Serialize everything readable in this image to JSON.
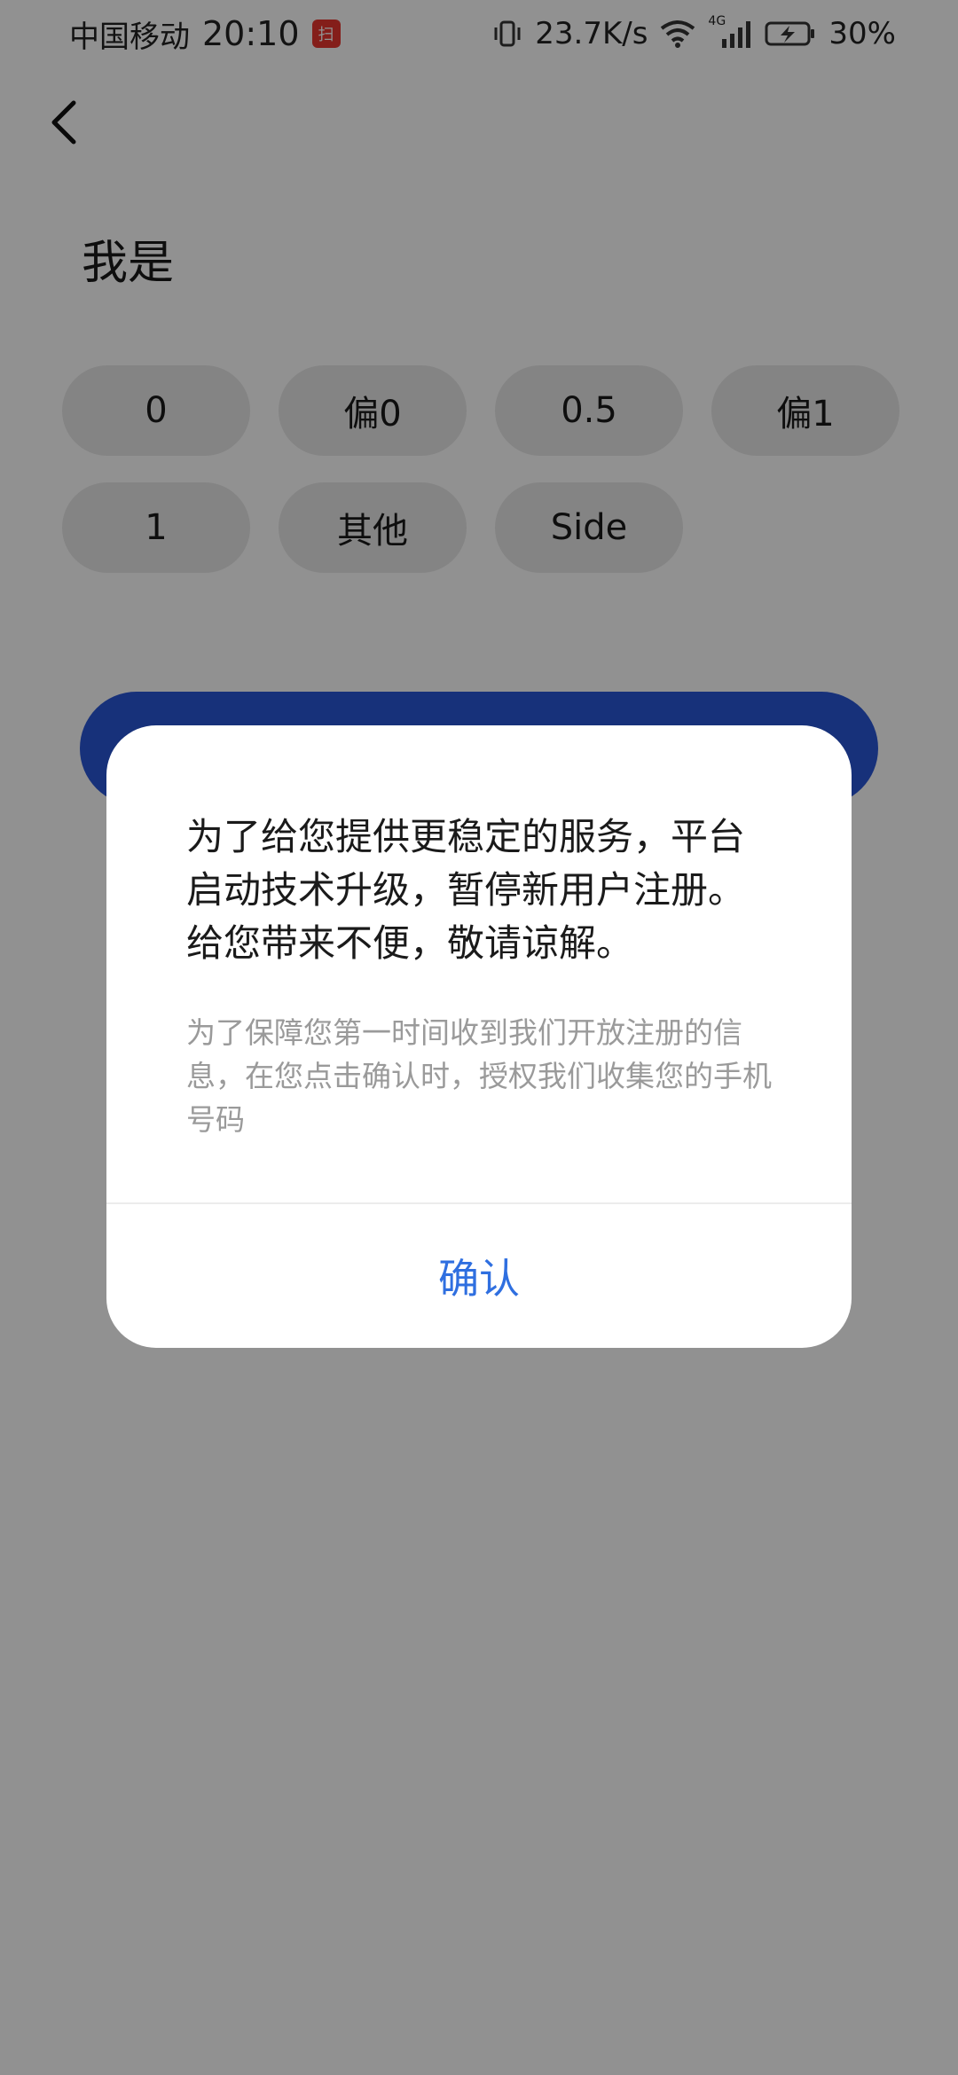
{
  "status_bar": {
    "carrier": "中国移动",
    "time": "20:10",
    "app_badge": "扫",
    "network_speed": "23.7K/s",
    "network_type": "4G",
    "battery": "30%",
    "icons": [
      "vibrate-icon",
      "wifi-icon",
      "signal-icon",
      "battery-charging-icon"
    ]
  },
  "page": {
    "title": "我是",
    "options": [
      "0",
      "偏0",
      "0.5",
      "偏1",
      "1",
      "其他",
      "Side"
    ],
    "accent_color": "#2a56d6"
  },
  "dialog": {
    "message": "为了给您提供更稳定的服务，平台启动技术升级，暂停新用户注册。给您带来不便，敬请谅解。",
    "note": "为了保障您第一时间收到我们开放注册的信息，在您点击确认时，授权我们收集您的手机号码",
    "confirm_label": "确认",
    "confirm_color": "#2f6fe0"
  }
}
